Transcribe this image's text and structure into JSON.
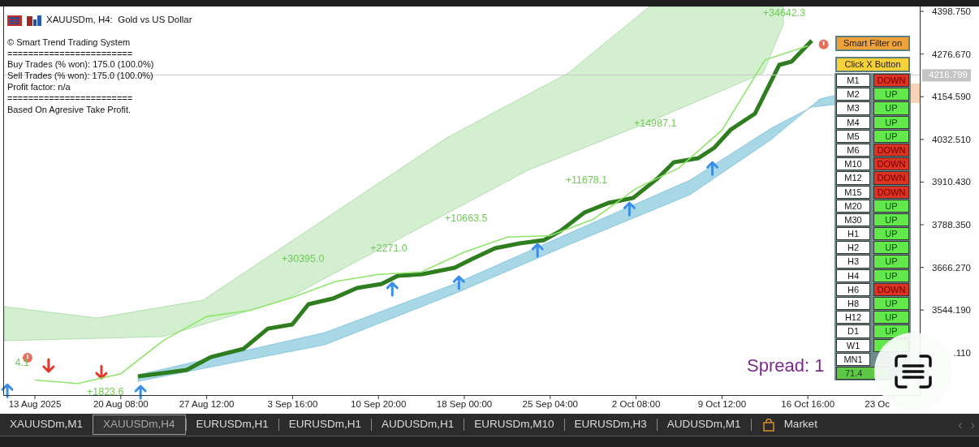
{
  "chart_header": {
    "title": "XAUUSDm, H4:  Gold vs US Dollar"
  },
  "info_lines": [
    "© Smart Trend Trading System",
    "========================",
    "Buy Trades (% won): 175.0 (100.0%)",
    "Sell Trades (% won): 175.0 (100.0%)",
    "Profit factor: n/a",
    "========================",
    "Based On Agresive Take Profit."
  ],
  "panel": {
    "buttons": [
      {
        "label": "Smart Filter on",
        "kind": "filter"
      },
      {
        "label": "Click X Button",
        "kind": "action"
      }
    ],
    "timeframes": [
      {
        "label": "M1",
        "value": "DOWN",
        "bullish": false
      },
      {
        "label": "M2",
        "value": "UP",
        "bullish": true
      },
      {
        "label": "M3",
        "value": "UP",
        "bullish": true
      },
      {
        "label": "M4",
        "value": "UP",
        "bullish": true
      },
      {
        "label": "M5",
        "value": "UP",
        "bullish": true
      },
      {
        "label": "M6",
        "value": "DOWN",
        "bullish": false
      },
      {
        "label": "M10",
        "value": "DOWN",
        "bullish": false
      },
      {
        "label": "M12",
        "value": "DOWN",
        "bullish": false
      },
      {
        "label": "M15",
        "value": "DOWN",
        "bullish": false
      },
      {
        "label": "M20",
        "value": "UP",
        "bullish": true
      },
      {
        "label": "M30",
        "value": "UP",
        "bullish": true
      },
      {
        "label": "H1",
        "value": "UP",
        "bullish": true
      },
      {
        "label": "H2",
        "value": "UP",
        "bullish": true
      },
      {
        "label": "H3",
        "value": "UP",
        "bullish": true
      },
      {
        "label": "H4",
        "value": "UP",
        "bullish": true
      },
      {
        "label": "H6",
        "value": "DOWN",
        "bullish": false
      },
      {
        "label": "H8",
        "value": "UP",
        "bullish": true
      },
      {
        "label": "H12",
        "value": "UP",
        "bullish": true
      },
      {
        "label": "D1",
        "value": "UP",
        "bullish": true
      },
      {
        "label": "W1",
        "bullish": true
      },
      {
        "label": "MN1"
      }
    ],
    "score": "71.4"
  },
  "spread": "Spread: 1",
  "price_label": "4216.799",
  "chart_data": {
    "type": "line",
    "categories": [
      "13 Aug 2025",
      null,
      "20 Aug 08:00",
      null,
      "27 Aug 12:00",
      null,
      "3 Sep 16:00",
      null,
      "10 Sep 20:00",
      null,
      "18 Sep 00:00",
      null,
      "25 Sep 04:00",
      null,
      "2 Oct 08:00",
      null,
      "9 Oct 12:00",
      null,
      "16 Oct 16:00",
      null,
      "23 Oc"
    ],
    "series": [
      {
        "color": "#8ee66a",
        "values": [
          3344,
          3334,
          3362,
          3458,
          3526,
          3543,
          3581,
          3626,
          3646,
          3653,
          3710,
          3753,
          3757,
          3804,
          3892,
          3951,
          4059,
          4260,
          4300,
          null,
          null
        ]
      }
    ],
    "ylim": [
      3301,
      4412.7
    ],
    "yticks": [
      {
        "value": 4398.75,
        "label": "4398.750"
      },
      {
        "value": 4276.67,
        "label": "4276.670"
      },
      {
        "value": 4154.59,
        "label": "4154.590"
      },
      {
        "value": 4032.51,
        "label": "4032.510"
      },
      {
        "value": 3910.43,
        "label": "3910.430"
      },
      {
        "value": 3788.35,
        "label": "3788.350"
      },
      {
        "value": 3666.27,
        "label": "3666.270"
      },
      {
        "value": 3544.19,
        "label": "3544.190"
      }
    ],
    "annotations": [
      "+30395.0",
      "+2271.0",
      "+10663.5",
      "+11678.1",
      "+14987.1",
      "+34642.3",
      "+1823.6",
      "4.1"
    ]
  },
  "cut_y_label": ".110",
  "tabs": [
    {
      "label": "XAUUSDm,M1",
      "selected": false
    },
    {
      "label": "XAUUSDm,H4",
      "selected": true
    },
    {
      "label": "EURUSDm,H1",
      "selected": false
    },
    {
      "label": "EURUSDm,H1",
      "selected": false
    },
    {
      "label": "AUDUSDm,H1",
      "selected": false
    },
    {
      "label": "EURUSDm,M10",
      "selected": false
    },
    {
      "label": "EURUSDm,H3",
      "selected": false
    },
    {
      "label": "AUDUSDm,M1",
      "selected": false
    }
  ],
  "market_tab": "Market",
  "scroll_arrows": [
    "‹",
    "›"
  ]
}
